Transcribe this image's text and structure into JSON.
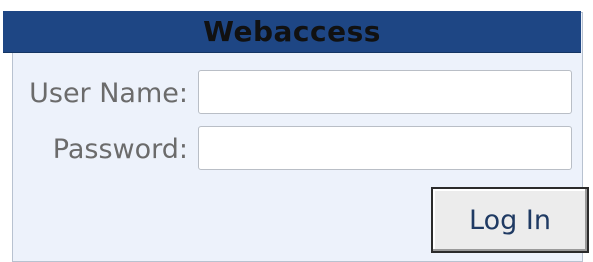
{
  "form": {
    "title": "Webaccess",
    "username": {
      "label": "User Name:",
      "value": "",
      "placeholder": ""
    },
    "password": {
      "label": "Password:",
      "value": "",
      "placeholder": ""
    },
    "submit_label": "Log In"
  },
  "colors": {
    "header_background": "#1e4684",
    "panel_background": "#edf2fb",
    "label_text": "#6b6b6b",
    "button_text": "#1f3a63"
  }
}
